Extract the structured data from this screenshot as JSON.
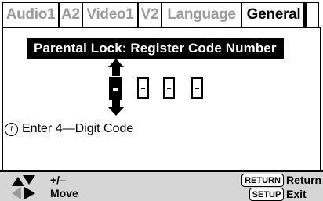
{
  "tabs": [
    {
      "label": "Audio1",
      "active": false
    },
    {
      "label": "A2",
      "active": false
    },
    {
      "label": "Video1",
      "active": false
    },
    {
      "label": "V2",
      "active": false
    },
    {
      "label": "Language",
      "active": false
    },
    {
      "label": "General",
      "active": true
    }
  ],
  "panel": {
    "heading": "Parental Lock: Register Code Number",
    "code_digits": [
      "",
      "",
      "",
      ""
    ],
    "selected_digit_index": 0,
    "hint_icon": "info-icon",
    "hint_text": "Enter 4—Digit Code"
  },
  "footer": {
    "change_icon": "up-down-arrows-icon",
    "change_label": "+/–",
    "move_icon": "left-right-arrows-icon",
    "move_label": "Move",
    "return_key": "RETURN",
    "return_label": "Return",
    "setup_key": "SETUP",
    "exit_label": "Exit"
  },
  "colors": {
    "inactive_tab_text": "#9a9a9a",
    "footer_bg": "#d6d6d6",
    "disabled_arrow": "#9a9a9a"
  }
}
